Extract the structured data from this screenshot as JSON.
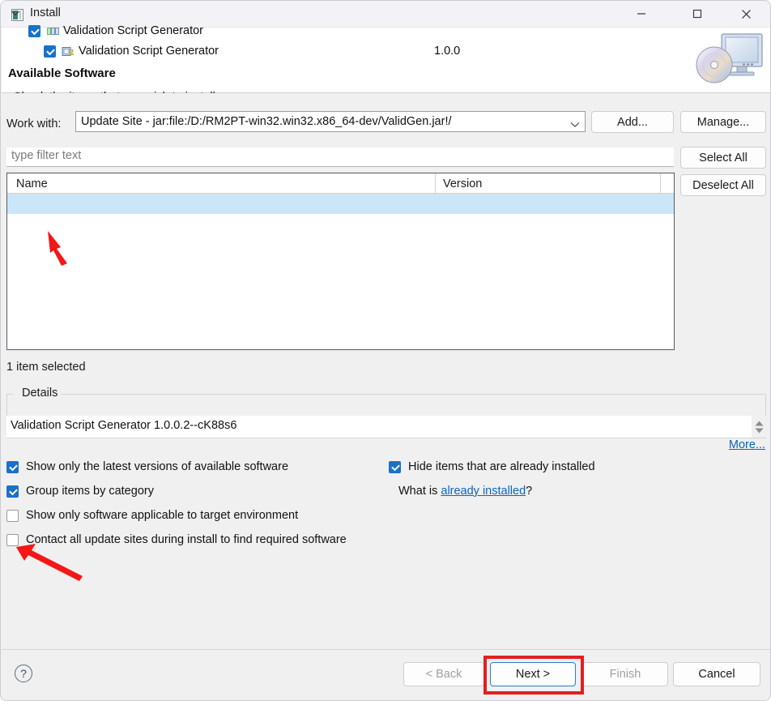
{
  "window": {
    "title": "Install",
    "icon": "eclipse-install-icon",
    "controls": {
      "minimize": "minimize-icon",
      "maximize": "maximize-icon",
      "close": "close-icon"
    }
  },
  "header": {
    "title": "Available Software",
    "subtitle": "Check the items that you wish to install.",
    "banner_icon": "monitor-cd-banner-icon"
  },
  "work_with": {
    "label": "Work with:",
    "value": "Update Site - jar:file:/D:/RM2PT-win32.win32.x86_64-dev/ValidGen.jar!/",
    "dropdown_icon": "chevron-down-icon"
  },
  "buttons": {
    "add": "Add...",
    "manage": "Manage...",
    "select_all": "Select All",
    "deselect_all": "Deselect All"
  },
  "filter": {
    "placeholder": "type filter text",
    "value": ""
  },
  "tree": {
    "columns": [
      "Name",
      "Version",
      ""
    ],
    "rows": [
      {
        "name": "Validation Script Generator",
        "version": "",
        "checked": true,
        "expanded": true,
        "selected": true,
        "level": 0,
        "icon": "category-icon"
      },
      {
        "name": "Validation Script Generator",
        "version": "1.0.0",
        "checked": true,
        "expanded": false,
        "selected": false,
        "level": 1,
        "icon": "feature-icon"
      }
    ]
  },
  "selection_info": "1 item selected",
  "details": {
    "legend": "Details",
    "text": "Validation Script Generator 1.0.0.2--cK88s6",
    "more_link": "More...",
    "spinner_icon": "spinner-updown-icon"
  },
  "options": [
    {
      "label": "Show only the latest versions of available software",
      "checked": true
    },
    {
      "label": "Group items by category",
      "checked": true
    },
    {
      "label": "Show only software applicable to target environment",
      "checked": false
    },
    {
      "label": "Contact all update sites during install to find required software",
      "checked": false
    },
    {
      "label": "Hide items that are already installed",
      "checked": true
    }
  ],
  "what_is": {
    "prefix": "What is ",
    "link": "already installed",
    "suffix": "?"
  },
  "footer": {
    "help_icon": "?",
    "back": "< Back",
    "next": "Next >",
    "finish": "Finish",
    "cancel": "Cancel"
  },
  "colors": {
    "accent": "#1a71c8",
    "link": "#0a66c2",
    "selection": "#cbe6f9",
    "annotation": "#e02020",
    "focus_border": "#2b7cd3"
  }
}
